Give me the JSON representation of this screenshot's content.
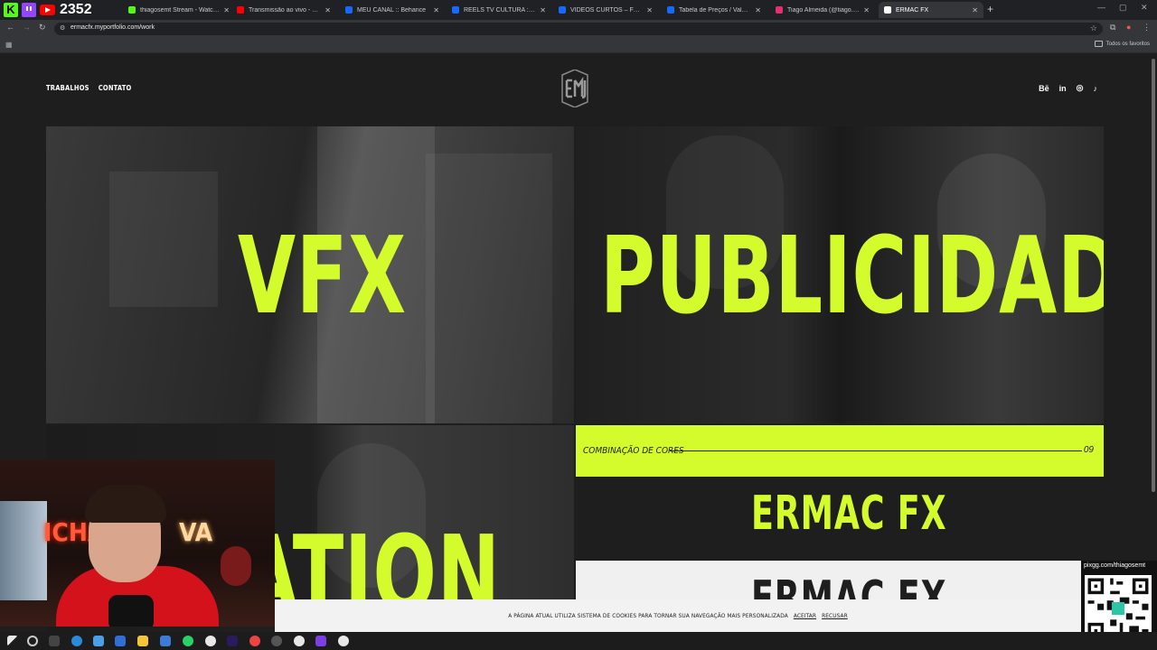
{
  "overlay": {
    "viewer_count": "2352"
  },
  "browser": {
    "tabs": [
      {
        "label": "thiagosemt Stream - Watch Live",
        "color": "#53fc18"
      },
      {
        "label": "Transmissão ao vivo - YouTube",
        "color": "#ff0000"
      },
      {
        "label": "MEU CANAL :: Behance",
        "color": "#1769ff"
      },
      {
        "label": "REELS TV CULTURA :: Behance",
        "color": "#1769ff"
      },
      {
        "label": "VIDEOS CURTOS – FELCA :: Behance",
        "color": "#1769ff"
      },
      {
        "label": "Tabela de Preços / Valores Tiragem",
        "color": "#1769ff"
      },
      {
        "label": "Tiago Almeida (@tiago.almeida)",
        "color": "#e1306c"
      },
      {
        "label": "ERMAC FX",
        "color": "#ffffff"
      }
    ],
    "url": "ermacfx.myportfolio.com/work",
    "bookmarks_label": "Todos os favoritos"
  },
  "site": {
    "nav": [
      "TRABALHOS",
      "CONTATO"
    ],
    "social": [
      "Bē",
      "in",
      "◎",
      "♪"
    ],
    "tiles": {
      "vfx": "VFX",
      "publicidade": "PUBLICIDADE",
      "animation": "ATION"
    },
    "cores_bar": {
      "label": "COMBINAÇÃO DE CORES",
      "number": "09"
    },
    "ermac_dark": "ERMAC FX",
    "ermac_light": "ERMAC FX",
    "cookie": {
      "text": "A PÁGINA ATUAL UTILIZA SISTEMA DE COOKIES PARA TORNAR SUA NAVEGAÇÃO MAIS PERSONALIZADA",
      "accept": "ACEITAR",
      "reject": "RECUSAR"
    }
  },
  "webcam": {
    "neon_left": "ICHA",
    "neon_right": "VA"
  },
  "pix": {
    "label": "pixgg.com/thiagosemt"
  },
  "colors": {
    "accent": "#d4fb2c",
    "page_bg": "#1e1e1e"
  }
}
